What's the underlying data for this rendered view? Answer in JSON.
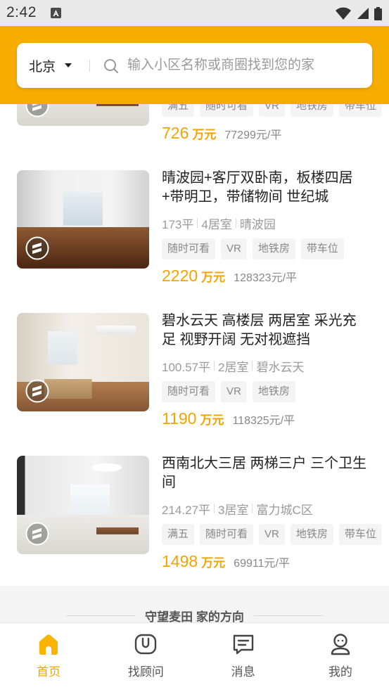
{
  "colors": {
    "status_bar_bg": "#E9E9E9",
    "header_bg": "#F7AD00",
    "accent": "#F5A300"
  },
  "status_bar": {
    "time": "2:42",
    "notification_icon": "a-notification-icon",
    "wifi_icon": "wifi-icon",
    "signal_icon": "signal-icon",
    "battery_icon": "battery-icon"
  },
  "search": {
    "city": "北京",
    "city_icon": "chevron-down-icon",
    "search_icon": "search-icon",
    "placeholder": "输入小区名称或商圈找到您的家"
  },
  "badge_icon": "brand-badge-icon",
  "listings": [
    {
      "tags": [
        "满五",
        "随时可看",
        "VR",
        "地铁房",
        "带车位"
      ],
      "price": "726",
      "price_unit": "万元",
      "unit_price": "77299元/平"
    },
    {
      "title": "晴波园+客厅双卧南，板楼四居+带明卫，带储物间 世纪城",
      "area": "173平",
      "rooms": "4居室",
      "community": "晴波园",
      "tags": [
        "随时可看",
        "VR",
        "地铁房",
        "带车位"
      ],
      "price": "2220",
      "price_unit": "万元",
      "unit_price": "128323元/平"
    },
    {
      "title": "碧水云天 高楼层 两居室 采光充足 视野开阔 无对视遮挡",
      "area": "100.57平",
      "rooms": "2居室",
      "community": "碧水云天",
      "tags": [
        "随时可看",
        "VR",
        "地铁房"
      ],
      "price": "1190",
      "price_unit": "万元",
      "unit_price": "118325元/平"
    },
    {
      "title": "西南北大三居 两梯三户 三个卫生间",
      "area": "214.27平",
      "rooms": "3居室",
      "community": "富力城C区",
      "tags": [
        "满五",
        "随时可看",
        "VR",
        "地铁房",
        "带车位"
      ],
      "price": "1498",
      "price_unit": "万元",
      "unit_price": "69911元/平"
    }
  ],
  "footer": {
    "tagline": "守望麦田 家的方向"
  },
  "nav": {
    "items": [
      {
        "label": "首页",
        "icon": "home-icon",
        "active": true
      },
      {
        "label": "找顾问",
        "icon": "advisor-icon",
        "active": false
      },
      {
        "label": "消息",
        "icon": "message-icon",
        "active": false
      },
      {
        "label": "我的",
        "icon": "profile-icon",
        "active": false
      }
    ]
  }
}
